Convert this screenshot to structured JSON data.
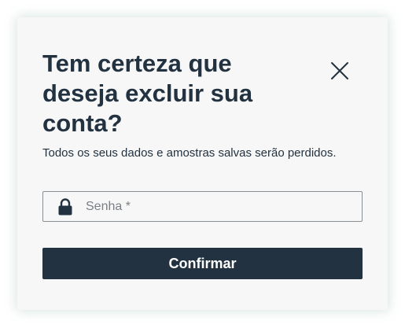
{
  "dialog": {
    "title": "Tem certeza que deseja excluir sua conta?",
    "subtitle": "Todos os seus dados e amostras salvas serão perdidos.",
    "close_icon": "close-icon",
    "password_field": {
      "icon": "lock-icon",
      "placeholder": "Senha *",
      "value": ""
    },
    "confirm_label": "Confirmar"
  },
  "colors": {
    "text": "#233241",
    "button_bg": "#233241",
    "button_text": "#ffffff",
    "dialog_bg": "#f7f7f7",
    "field_border": "#8a8f94"
  }
}
